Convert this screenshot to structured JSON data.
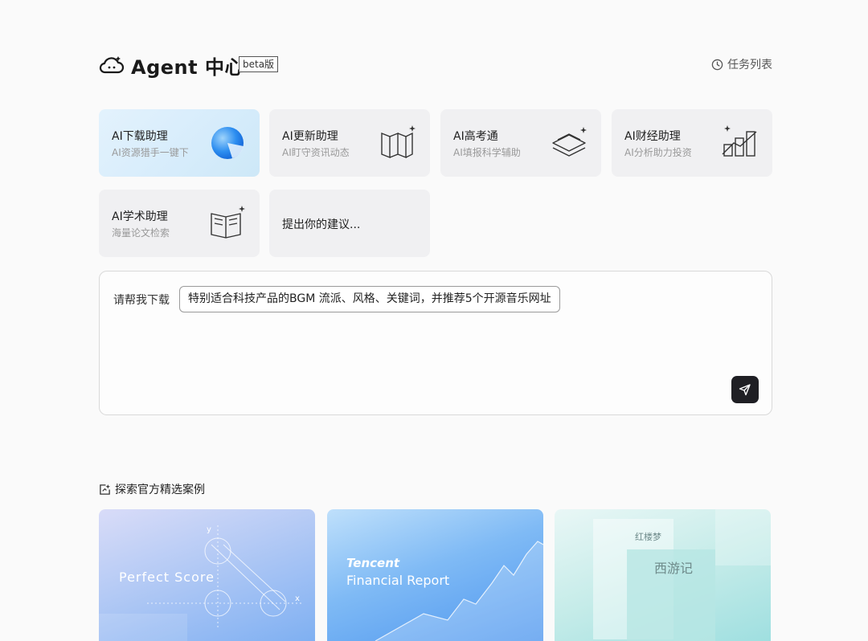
{
  "header": {
    "logo_icon": "cloud-face-icon",
    "title": "Agent 中心",
    "badge": "beta版",
    "task_list_label": "任务列表",
    "task_list_icon": "clock-icon"
  },
  "cards": [
    {
      "title": "AI下载助理",
      "subtitle": "AI资源猎手一键下",
      "icon": "sphere-icon",
      "active": true
    },
    {
      "title": "AI更新助理",
      "subtitle": "AI盯守资讯动态",
      "icon": "pages-sparkle-icon",
      "active": false
    },
    {
      "title": "AI高考通",
      "subtitle": "AI填报科学辅助",
      "icon": "layers-sparkle-icon",
      "active": false
    },
    {
      "title": "AI财经助理",
      "subtitle": "AI分析助力投资",
      "icon": "chart-sparkle-icon",
      "active": false
    },
    {
      "title": "AI学术助理",
      "subtitle": "海量论文检索",
      "icon": "book-sparkle-icon",
      "active": false
    }
  ],
  "suggest_card": {
    "label": "提出你的建议..."
  },
  "input": {
    "prefix": "请帮我下载",
    "chip_text": "特别适合科技产品的BGM 流派、风格、关键词，并推荐5个开源音乐网址",
    "send_icon": "send-icon"
  },
  "explore": {
    "title": "探索官方精选案例",
    "icon": "sparkle-frame-icon",
    "cases": [
      {
        "text": "Perfect Score",
        "icon": "geometry-graph-icon"
      },
      {
        "brand": "Tencent",
        "text": "Financial Report",
        "icon": "mountain-chart-icon"
      },
      {
        "text_small": "红楼梦",
        "text": "西游记",
        "icon": "book-covers-icon"
      }
    ]
  },
  "colors": {
    "accent_dark": "#1f1f24",
    "active_card": "#d6ecfb",
    "card_bg": "#f0f0f2"
  }
}
